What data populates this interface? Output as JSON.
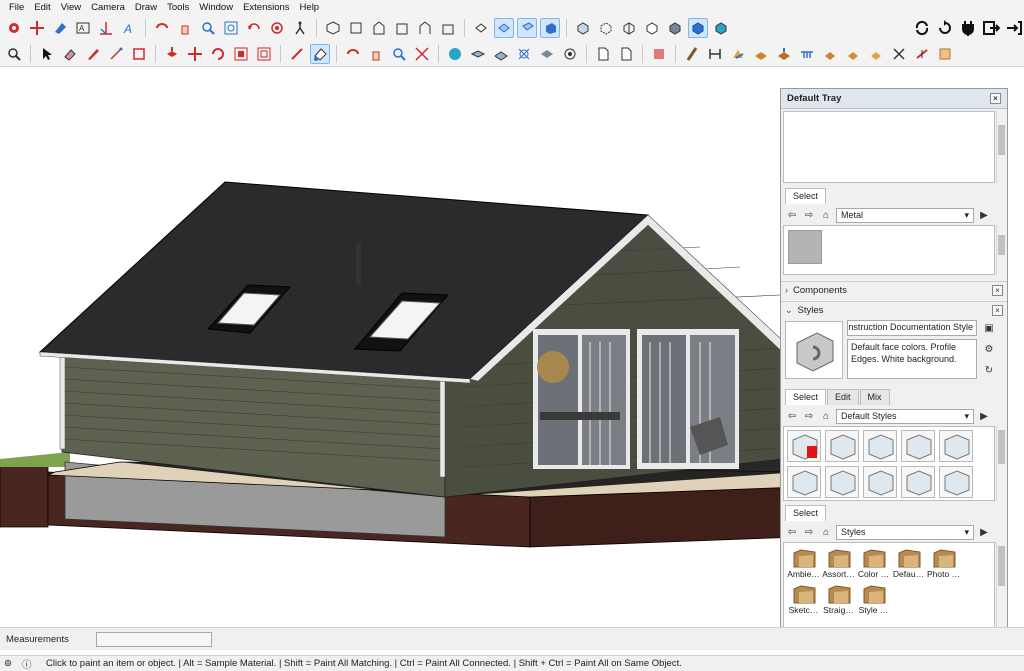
{
  "menu": [
    "File",
    "Edit",
    "View",
    "Camera",
    "Draw",
    "Tools",
    "Window",
    "Extensions",
    "Help"
  ],
  "toolbar_row1_icons": [
    "select-tool-icon",
    "move-tool-icon",
    "paint-bucket-icon",
    "text-tool-icon",
    "axes-tool-icon",
    "dimension-tool-icon",
    "orbit-icon",
    "pan-icon",
    "zoom-icon",
    "zoom-window-icon",
    "previous-view-icon",
    "position-camera-icon",
    "walk-icon",
    "look-around-icon",
    "iso-view-icon",
    "top-view-icon",
    "front-view-icon",
    "right-view-icon",
    "back-view-icon",
    "left-view-icon",
    "section-plane-icon",
    "display-section-planes-icon",
    "display-section-cuts-icon",
    "section-fill-icon",
    "xray-icon",
    "back-edges-icon",
    "wireframe-icon",
    "hidden-line-icon",
    "shaded-icon",
    "shaded-textures-icon",
    "monochrome-icon",
    "sync-icon",
    "reload-icon",
    "plugin-icon",
    "export-icon",
    "signout-icon"
  ],
  "toolbar_row2_icons": [
    "zoom-extents-icon",
    "select-arrow-icon",
    "eraser-icon",
    "pencil-icon",
    "line-icon",
    "rectangle-icon",
    "push-pull-icon",
    "move-icon",
    "rotate-icon",
    "scale-icon",
    "offset-icon",
    "tape-measure-icon",
    "paint-bucket-active-icon",
    "orbit-small-icon",
    "pan-small-icon",
    "zoom-small-icon",
    "zoom-extents-small-icon",
    "geo-location-icon",
    "add-location-icon",
    "terrain-icon",
    "warehouse-icon",
    "extension-warehouse-icon",
    "layout-icon",
    "new-file-icon",
    "open-file-icon",
    "section-tools-icon",
    "sandbox-icon",
    "stamp-icon",
    "drape-icon",
    "flip-icon",
    "smoove-icon",
    "add-detail-icon",
    "solid-tools-icon",
    "union-icon",
    "subtract-icon",
    "trim-icon",
    "split-icon",
    "outer-shell-icon"
  ],
  "colors": {
    "menubar_bg": "#f3f3f3",
    "roof": "#2a2b2d",
    "siding": "#5c6150",
    "siding_dark": "#4a4e40",
    "foundation": "#9a9a9a",
    "ground": "#4a2620",
    "grass": "#7ea34e",
    "trim": "#e9e9e9",
    "accent_blue": "#2f6fd0",
    "active_tool": "#cfe6fb"
  },
  "tray": {
    "title": "Default Tray",
    "materials": {
      "tab_select": "Select",
      "dropdown_value": "Metal"
    },
    "components_label": "Components",
    "styles": {
      "label": "Styles",
      "style_name": "Construction Documentation Style",
      "description": "Default face colors. Profile Edges. White background.",
      "tabs": [
        "Select",
        "Edit",
        "Mix"
      ],
      "dropdown_value": "Default Styles",
      "thumbnails": [
        "style-thumb-1",
        "style-thumb-2",
        "style-thumb-3",
        "style-thumb-4",
        "style-thumb-5",
        "style-thumb-6",
        "style-thumb-7",
        "style-thumb-8",
        "style-thumb-9",
        "style-thumb-10"
      ]
    },
    "lower_select": {
      "tab_select": "Select",
      "dropdown_value": "Styles",
      "folders": [
        "Ambie…",
        "Assort…",
        "Color …",
        "Defau…",
        "Photo …",
        "Sketc…",
        "Straig…",
        "Style …"
      ]
    }
  },
  "measurements": {
    "label": "Measurements",
    "value": ""
  },
  "status": {
    "message": "Click to paint an item or object. | Alt = Sample Material. | Shift = Paint All Matching. | Ctrl = Paint All Connected. | Shift + Ctrl = Paint All on Same Object."
  }
}
